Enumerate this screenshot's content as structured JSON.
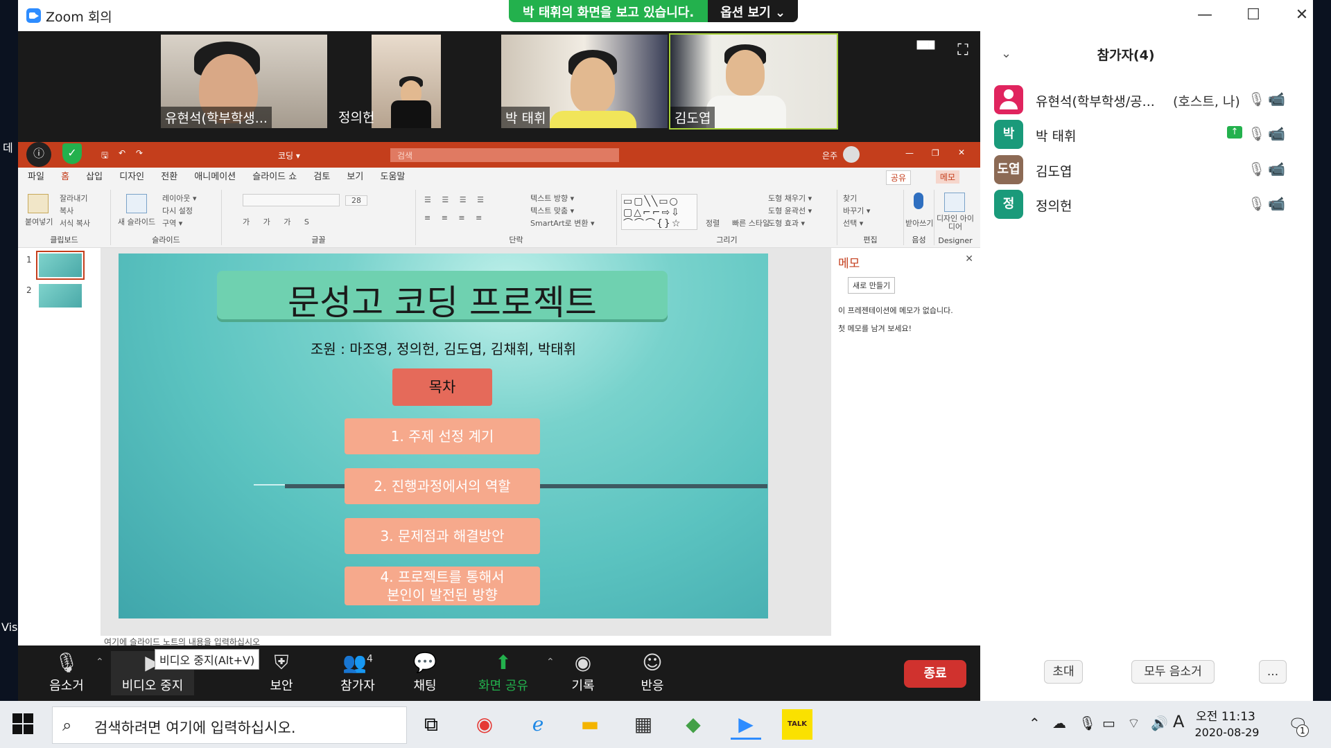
{
  "desktop": {
    "edge_texts": [
      "데",
      "Vis"
    ]
  },
  "titlebar": {
    "title": "Zoom 회의",
    "viewing_banner": "박 태휘의 화면을 보고 있습니다.",
    "view_options": "옵션 보기 ⌄",
    "minimize": "—",
    "maximize": "☐",
    "close": "✕"
  },
  "videos": [
    {
      "name": "유현석(학부학생..."
    },
    {
      "name": "정의헌"
    },
    {
      "name": "박 태휘"
    },
    {
      "name": "김도엽"
    }
  ],
  "ppt": {
    "doc_name": "코딩 ▾",
    "search_placeholder": "검색",
    "user": "은주",
    "menu": [
      "파일",
      "홈",
      "삽입",
      "디자인",
      "전환",
      "애니메이션",
      "슬라이드 쇼",
      "검토",
      "보기",
      "도움말"
    ],
    "share_button": "공유",
    "memo_button": "메모",
    "ribbon": {
      "paste": "붙여넣기",
      "cut": "잘라내기",
      "copy": "복사",
      "format_painter": "서식 복사",
      "clipboard_label": "클립보드",
      "new_slide": "새 슬라이드",
      "layout": "레이아웃 ▾",
      "reset": "다시 설정",
      "section": "구역 ▾",
      "slides_label": "슬라이드",
      "font_size": "28",
      "font_label": "글꼴",
      "text_direction": "텍스트 방향 ▾",
      "text_align": "텍스트 맞춤 ▾",
      "smartart": "SmartArt로 변환 ▾",
      "paragraph_label": "단락",
      "arrange": "정렬",
      "quick_styles": "빠른 스타일",
      "shape_fill": "도형 채우기 ▾",
      "shape_outline": "도형 윤곽선 ▾",
      "shape_effects": "도형 효과 ▾",
      "drawing_label": "그리기",
      "find": "찾기",
      "replace": "바꾸기 ▾",
      "select": "선택 ▾",
      "editing_label": "편집",
      "dictate": "받아쓰기",
      "voice_label": "음성",
      "designer_ideas": "디자인 아이디어",
      "designer_label": "Designer"
    },
    "thumbnails": [
      "1",
      "2"
    ],
    "slide": {
      "title": "문성고 코딩 프로젝트",
      "members": "조원 : 마조영, 정의헌, 김도엽, 김채휘, 박태휘",
      "toc_header": "목차",
      "toc": [
        "1. 주제 선정 계기",
        "2. 진행과정에서의 역할",
        "3. 문제점과 해결방안",
        "4. 프로젝트를 통해서\n본인이 발전된 방향"
      ]
    },
    "memo": {
      "title": "메모",
      "new_button": "새로 만들기",
      "empty_line1": "이 프레젠테이션에 메모가 없습니다.",
      "empty_line2": "첫 메모를 남겨 보세요!"
    },
    "notes_placeholder": "여기에 슬라이드 노트의 내용을 입력하십시오"
  },
  "controls": {
    "mute": "음소거",
    "stop_video": "비디오 중지",
    "video_tooltip": "비디오 중지(Alt+V)",
    "security": "보안",
    "participants": "참가자",
    "participants_count": "4",
    "chat": "채팅",
    "share_screen": "화면 공유",
    "record": "기록",
    "reactions": "반응",
    "end": "종료"
  },
  "participants_panel": {
    "title": "참가자(4)",
    "list": [
      {
        "initials": "",
        "name": "유현석(학부학생/공...",
        "role": "(호스트, 나)",
        "color": "#e0245e"
      },
      {
        "initials": "박",
        "name": "박 태휘",
        "role": "",
        "color": "#1a9a7a"
      },
      {
        "initials": "도엽",
        "name": "김도엽",
        "role": "",
        "color": "#8c6a55"
      },
      {
        "initials": "정",
        "name": "정의헌",
        "role": "",
        "color": "#1a9a7a"
      }
    ],
    "invite": "초대",
    "mute_all": "모두 음소거",
    "more": "..."
  },
  "taskbar": {
    "search_placeholder": "검색하려면 여기에 입력하십시오.",
    "clock_time": "오전 11:13",
    "clock_date": "2020-08-29",
    "ime": "A",
    "notification_count": "1",
    "kakao": "TALK"
  }
}
